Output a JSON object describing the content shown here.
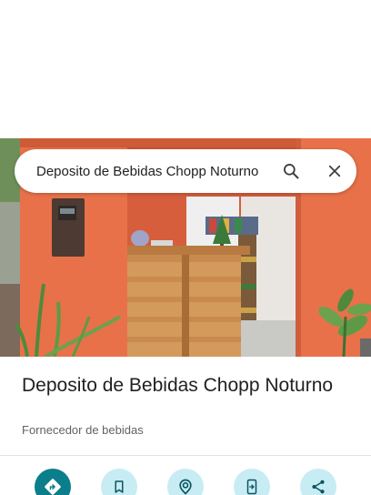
{
  "search": {
    "query": "Deposito de Bebidas Chopp Noturno"
  },
  "place": {
    "name": "Deposito de Bebidas Chopp Noturno",
    "category": "Fornecedor de bebidas"
  },
  "actions": [
    {
      "icon": "directions-icon"
    },
    {
      "icon": "bookmark-icon"
    },
    {
      "icon": "nearby-icon"
    },
    {
      "icon": "send-to-phone-icon"
    },
    {
      "icon": "share-icon"
    }
  ],
  "colors": {
    "primary_action": "#0b7e8c",
    "secondary_action": "#c8ecf4",
    "wall": "#e8704a"
  }
}
